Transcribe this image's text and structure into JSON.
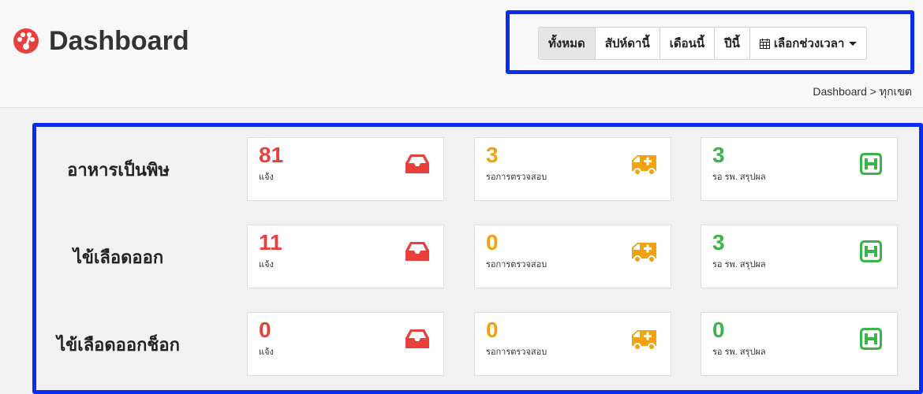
{
  "header": {
    "title": "Dashboard",
    "range_buttons": [
      "ทั้งหมด",
      "สัปห์ดานี้",
      "เดือนนี้",
      "ปีนี้",
      "เลือกช่วงเวลา"
    ],
    "active_range": "ทั้งหมด",
    "breadcrumb": "Dashboard > ทุกเขต"
  },
  "rows": [
    {
      "label": "อาหารเป็นพิษ",
      "cards": [
        {
          "value": "81",
          "caption": "แจ้ง",
          "icon": "inbox-icon",
          "color": "#e8413d"
        },
        {
          "value": "3",
          "caption": "รอการตรวจสอบ",
          "icon": "ambulance-icon",
          "color": "#f2a20e"
        },
        {
          "value": "3",
          "caption": "รอ รพ. สรุปผล",
          "icon": "hospital-icon",
          "color": "#3bb54a"
        }
      ]
    },
    {
      "label": "ไข้เลือดออก",
      "cards": [
        {
          "value": "11",
          "caption": "แจ้ง",
          "icon": "inbox-icon",
          "color": "#e8413d"
        },
        {
          "value": "0",
          "caption": "รอการตรวจสอบ",
          "icon": "ambulance-icon",
          "color": "#f2a20e"
        },
        {
          "value": "3",
          "caption": "รอ รพ. สรุปผล",
          "icon": "hospital-icon",
          "color": "#3bb54a"
        }
      ]
    },
    {
      "label": "ไข้เลือดออกช็อก",
      "cards": [
        {
          "value": "0",
          "caption": "แจ้ง",
          "icon": "inbox-icon",
          "color": "#e8413d"
        },
        {
          "value": "0",
          "caption": "รอการตรวจสอบ",
          "icon": "ambulance-icon",
          "color": "#f2a20e"
        },
        {
          "value": "0",
          "caption": "รอ รพ. สรุปผล",
          "icon": "hospital-icon",
          "color": "#3bb54a"
        }
      ]
    }
  ],
  "colors": {
    "red": "#e8413d",
    "orange": "#f2a20e",
    "green": "#3bb54a",
    "highlight": "#0a2cf0"
  }
}
